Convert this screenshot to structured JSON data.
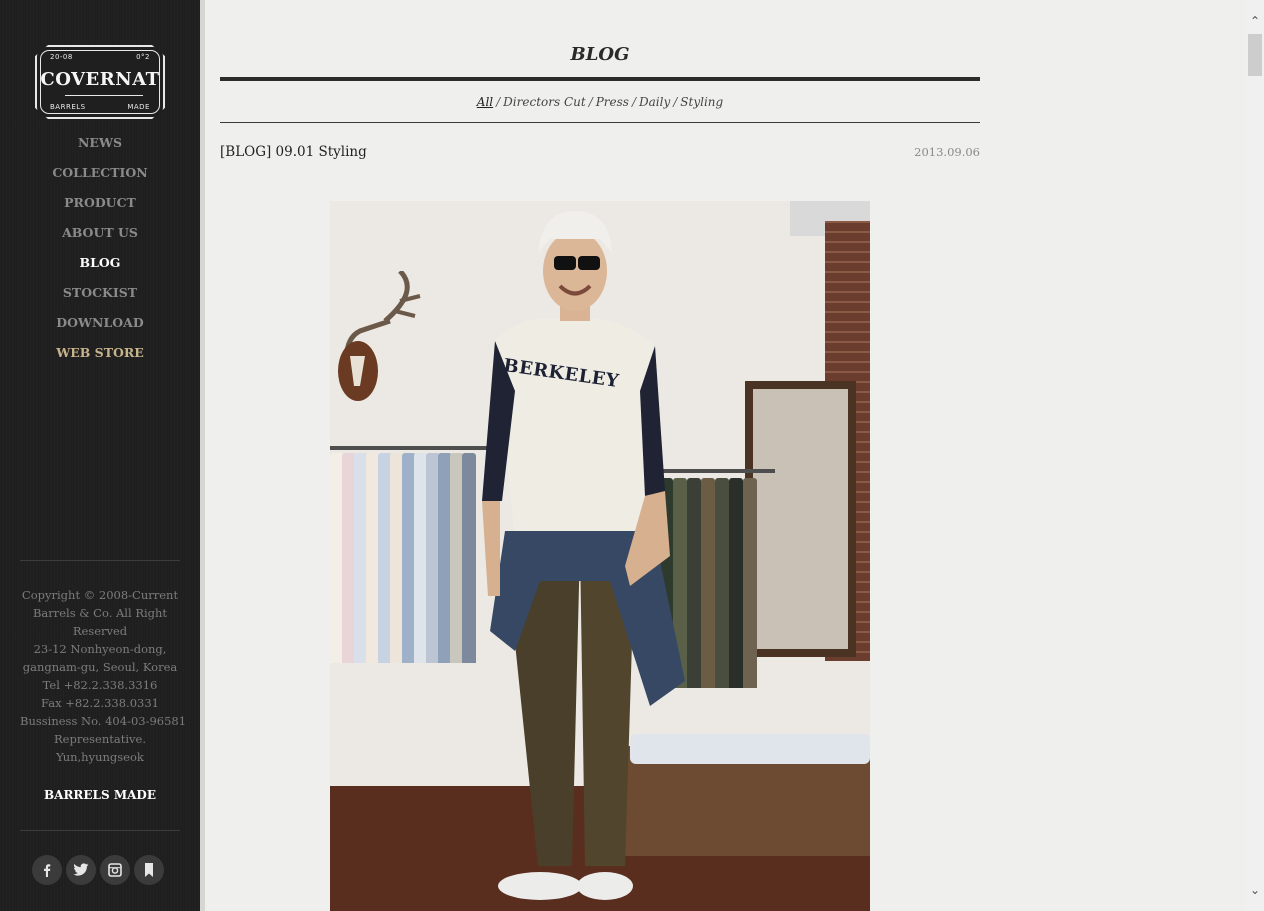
{
  "logo": {
    "year_left": "20-08",
    "year_right": "0°2",
    "name": "COVERNAT",
    "bottom_left": "BARRELS",
    "bottom_right": "MADE"
  },
  "nav": [
    {
      "label": "NEWS"
    },
    {
      "label": "COLLECTION"
    },
    {
      "label": "PRODUCT"
    },
    {
      "label": "ABOUT US"
    },
    {
      "label": "BLOG"
    },
    {
      "label": "STOCKIST"
    },
    {
      "label": "DOWNLOAD"
    },
    {
      "label": "WEB STORE"
    }
  ],
  "footer": {
    "lines": [
      "Copyright © 2008-Current",
      "Barrels & Co. All Right",
      "Reserved",
      "23-12 Nonhyeon-dong,",
      "gangnam-gu, Seoul, Korea",
      "Tel +82.2.338.3316",
      "Fax +82.2.338.0331",
      "Bussiness No. 404-03-96581",
      "Representative.",
      "Yun,hyungseok"
    ],
    "brand": "BARRELS MADE"
  },
  "social": [
    "facebook-icon",
    "twitter-icon",
    "instagram-icon",
    "bookmark-icon"
  ],
  "page": {
    "title": "BLOG",
    "categories": [
      "All",
      "Directors Cut",
      "Press",
      "Daily",
      "Styling"
    ],
    "active_category": "All"
  },
  "post": {
    "title": "[BLOG] 09.01 Styling",
    "date": "2013.09.06",
    "shirt_text": "BERKELEY"
  },
  "colors": {
    "sidebar_bg": "#1f1f1f",
    "page_bg": "#efefed",
    "nav_inactive": "#8a8a8a",
    "nav_active": "#ffffff",
    "web_store": "#c7b48c"
  }
}
